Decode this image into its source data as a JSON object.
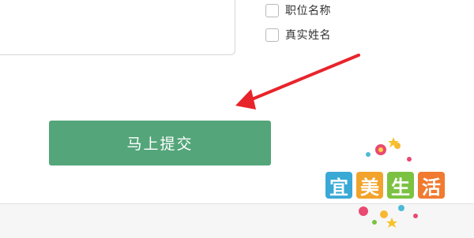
{
  "form": {
    "options": [
      {
        "label": "职位名称",
        "checked": false
      },
      {
        "label": "真实姓名",
        "checked": false
      }
    ],
    "submit_label": "马上提交"
  },
  "watermark": {
    "characters": [
      "宜",
      "美",
      "生",
      "活"
    ],
    "colors": [
      "#3aa9d6",
      "#f2a32b",
      "#7cc242",
      "#f07a2f"
    ]
  },
  "colors": {
    "button": "#54a57a",
    "arrow": "#e8242b"
  }
}
